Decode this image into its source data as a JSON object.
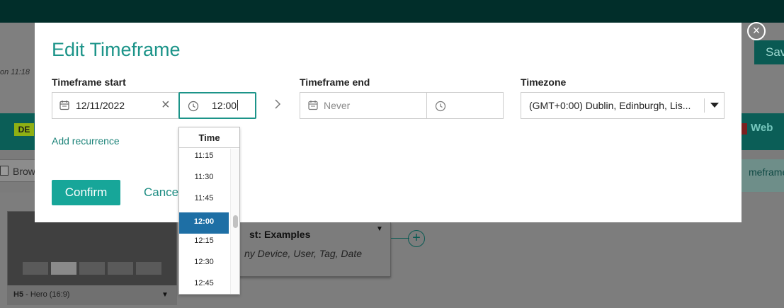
{
  "background": {
    "last_saved_text": "on 11:18",
    "save_label": "Sav",
    "badge": "DE",
    "web_label": "Web",
    "browse_label": "Brow",
    "timeframe_tab": "meframe",
    "card_footer_bold": "H5",
    "card_footer_rest": " - Hero (16:9)",
    "examples_title": "st: Examples",
    "examples_sub": "ny Device, User, Tag, Date"
  },
  "modal": {
    "title": "Edit Timeframe",
    "close_label": "×",
    "start": {
      "label": "Timeframe start",
      "date_value": "12/11/2022",
      "clear_label": "×",
      "time_value": "12:00"
    },
    "end": {
      "label": "Timeframe end",
      "date_placeholder": "Never",
      "time_value": ""
    },
    "timezone": {
      "label": "Timezone",
      "value": "(GMT+0:00) Dublin, Edinburgh, Lis..."
    },
    "add_recurrence": "Add recurrence",
    "confirm_label": "Confirm",
    "cancel_label": "Cance"
  },
  "time_dropdown": {
    "header": "Time",
    "items": [
      {
        "label": "11:15",
        "selected": false
      },
      {
        "label": "11:30",
        "selected": false
      },
      {
        "label": "11:45",
        "selected": false
      },
      {
        "label": "12:00",
        "selected": true
      },
      {
        "label": "12:15",
        "selected": false
      },
      {
        "label": "12:30",
        "selected": false
      },
      {
        "label": "12:45",
        "selected": false
      }
    ]
  },
  "colors": {
    "accent": "#1c9489",
    "selected_time": "#1e6fa5",
    "confirm_button": "#17a699"
  },
  "icons": {
    "start_date": "calendar-icon",
    "start_time": "clock-icon",
    "end_date": "calendar-icon",
    "end_time": "clock-icon",
    "arrow": "chevron-right-icon",
    "timezone": "caret-down-icon",
    "close": "close-icon",
    "clear": "clear-icon"
  }
}
